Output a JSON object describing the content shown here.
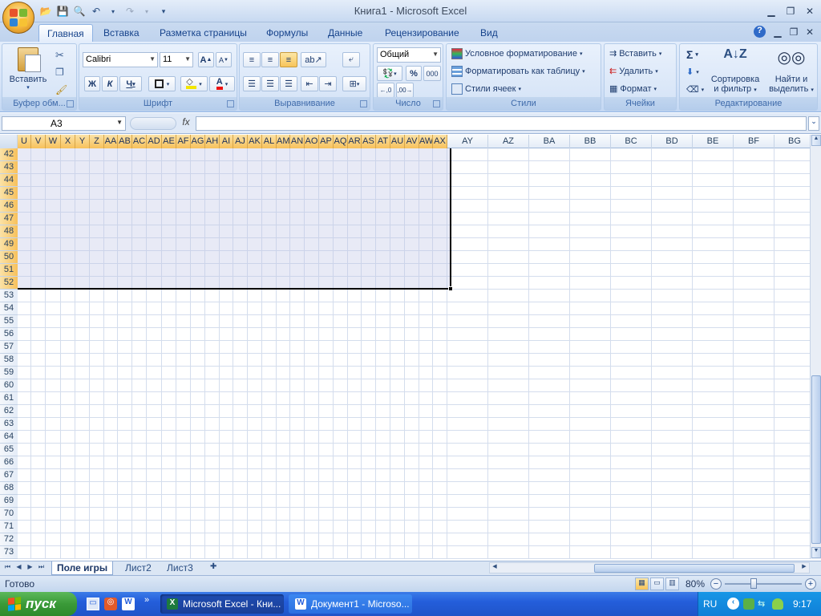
{
  "window": {
    "title": "Книга1 - Microsoft Excel"
  },
  "tabs": [
    "Главная",
    "Вставка",
    "Разметка страницы",
    "Формулы",
    "Данные",
    "Рецензирование",
    "Вид"
  ],
  "active_tab": "Главная",
  "ribbon": {
    "clipboard": {
      "label": "Буфер обм...",
      "paste": "Вставить"
    },
    "font": {
      "label": "Шрифт",
      "font_name": "Calibri",
      "font_size": "11",
      "bold": "Ж",
      "italic": "К",
      "underline": "Ч",
      "grow": "A",
      "shrink": "A"
    },
    "alignment": {
      "label": "Выравнивание"
    },
    "number": {
      "label": "Число",
      "format": "Общий",
      "percent": "%",
      "thousands": "000"
    },
    "styles": {
      "label": "Стили",
      "cond": "Условное форматирование",
      "table": "Форматировать как таблицу",
      "cell": "Стили ячеек"
    },
    "cells": {
      "label": "Ячейки",
      "insert": "Вставить",
      "delete": "Удалить",
      "format": "Формат"
    },
    "editing": {
      "label": "Редактирование",
      "sum": "Σ",
      "sort1": "Сортировка",
      "sort2": "и фильтр",
      "find1": "Найти и",
      "find2": "выделить"
    }
  },
  "formula_bar": {
    "name_box": "A3",
    "fx": "fx",
    "formula": ""
  },
  "columns": [
    "U",
    "V",
    "W",
    "X",
    "Y",
    "Z",
    "AA",
    "AB",
    "AC",
    "AD",
    "AE",
    "AF",
    "AG",
    "AH",
    "AI",
    "AJ",
    "AK",
    "AL",
    "AM",
    "AN",
    "AO",
    "AP",
    "AQ",
    "AR",
    "AS",
    "AT",
    "AU",
    "AV",
    "AW",
    "AX",
    "AY",
    "AZ",
    "BA",
    "BB",
    "BC",
    "BD",
    "BE",
    "BF",
    "BG"
  ],
  "rows": [
    "42",
    "43",
    "44",
    "45",
    "46",
    "47",
    "48",
    "49",
    "50",
    "51",
    "52",
    "53",
    "54",
    "55",
    "56",
    "57",
    "58",
    "59",
    "60",
    "61",
    "62",
    "63",
    "64",
    "65",
    "66",
    "67",
    "68",
    "69",
    "70",
    "71",
    "72",
    "73"
  ],
  "sheets": [
    "Поле игры",
    "Лист2",
    "Лист3"
  ],
  "active_sheet": "Поле игры",
  "status": {
    "text": "Готово",
    "zoom": "80%"
  },
  "taskbar": {
    "start": "пуск",
    "tasks": [
      "Microsoft Excel - Кни...",
      "Документ1 - Microso..."
    ],
    "lang": "RU",
    "clock": "9:17"
  }
}
